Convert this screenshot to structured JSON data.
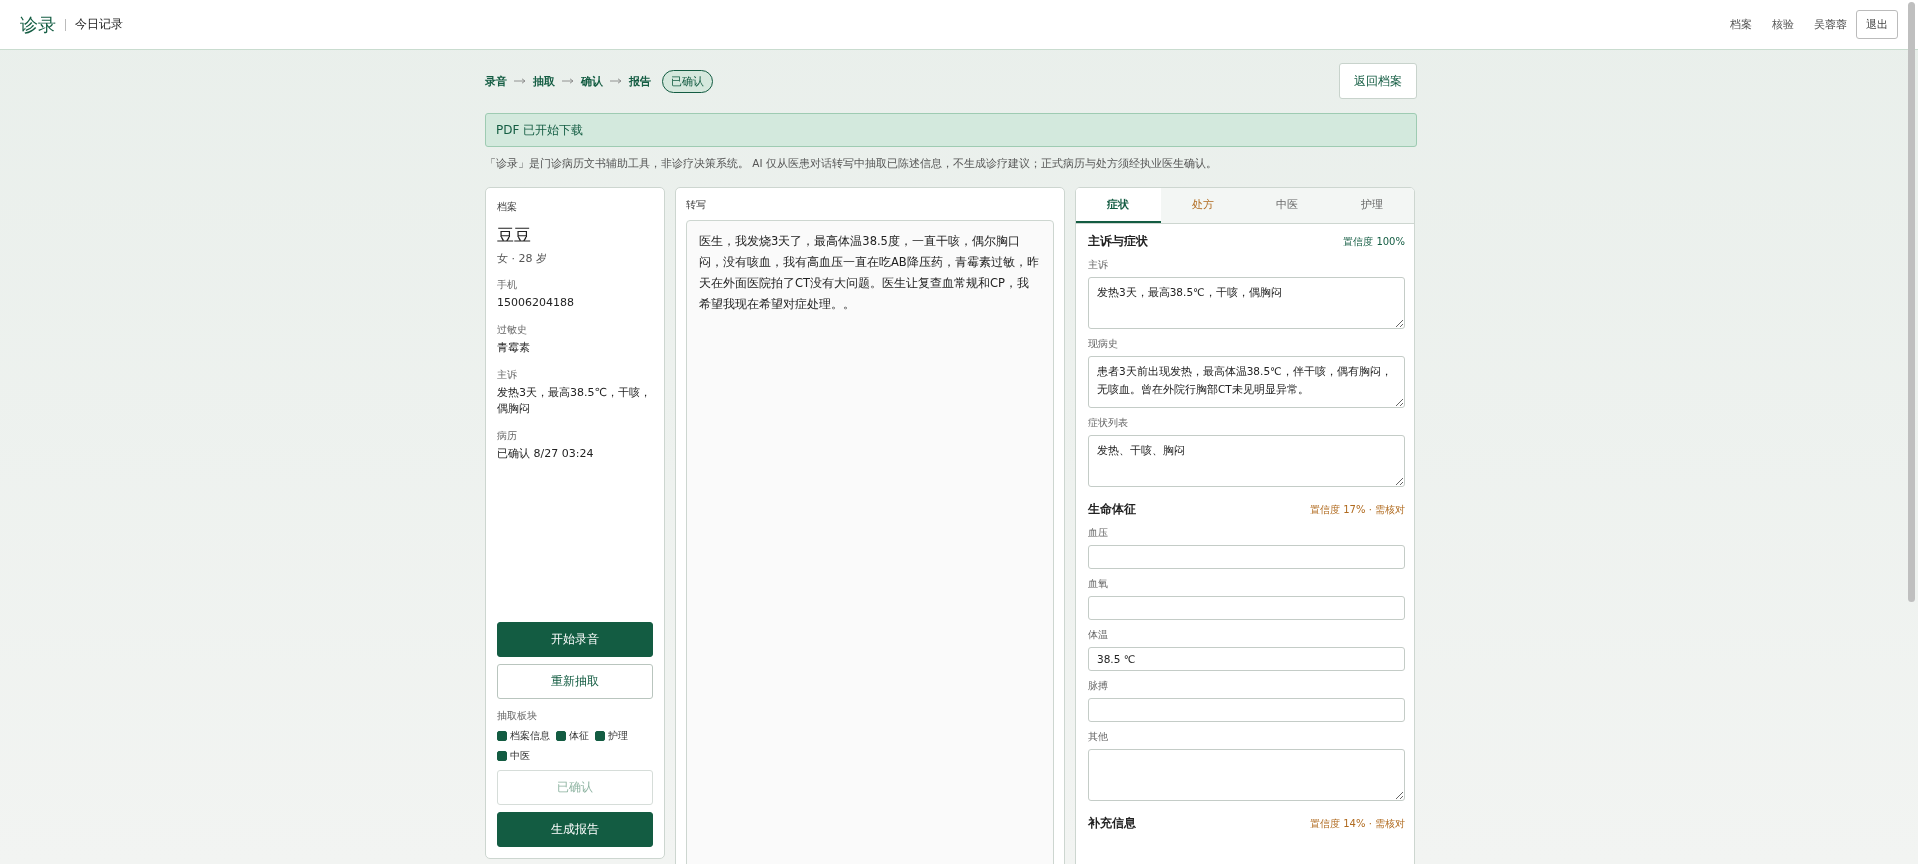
{
  "header": {
    "logo": "诊录",
    "subtitle": "今日记录",
    "nav": [
      "档案",
      "核验"
    ],
    "user": "吴蓉蓉",
    "logout": "退出"
  },
  "steps": [
    "录音",
    "抽取",
    "确认",
    "报告"
  ],
  "status_badge": "已确认",
  "back_button": "返回档案",
  "alert": "PDF 已开始下载",
  "disclaimer": "「诊录」是门诊病历文书辅助工具，非诊疗决策系统。 AI 仅从医患对话转写中抽取已陈述信息，不生成诊疗建议；正式病历与处方须经执业医生确认。",
  "profile": {
    "title": "档案",
    "name": "豆豆",
    "meta": "女 · 28 岁",
    "fields": [
      {
        "label": "手机",
        "value": "15006204188"
      },
      {
        "label": "过敏史",
        "value": "青霉素"
      },
      {
        "label": "主诉",
        "value": "发热3天，最高38.5℃，干咳，偶胸闷"
      },
      {
        "label": "病历",
        "value": "已确认 8/27 03:24"
      }
    ],
    "buttons_top": [
      {
        "label": "开始录音",
        "kind": "primary",
        "disabled": false
      },
      {
        "label": "重新抽取",
        "kind": "outline",
        "disabled": false
      }
    ],
    "modules_label": "抽取板块",
    "modules": [
      {
        "label": "档案信息",
        "checked": true
      },
      {
        "label": "体征",
        "checked": true
      },
      {
        "label": "护理",
        "checked": true
      },
      {
        "label": "中医",
        "checked": true
      }
    ],
    "buttons_bottom": [
      {
        "label": "已确认",
        "kind": "outline",
        "disabled": true
      },
      {
        "label": "生成报告",
        "kind": "primary",
        "disabled": false
      }
    ]
  },
  "transcript": {
    "title": "转写",
    "text": "医生，我发烧3天了，最高体温38.5度，一直干咳，偶尔胸口闷，没有咳血，我有高血压一直在吃AB降压药，青霉素过敏，昨天在外面医院拍了CT没有大问题。医生让复查血常规和CP，我希望我现在希望对症处理。。"
  },
  "tabs": [
    {
      "label": "症状",
      "selected": true,
      "warning": false
    },
    {
      "label": "处方",
      "selected": false,
      "warning": true
    },
    {
      "label": "中医",
      "selected": false,
      "warning": false
    },
    {
      "label": "护理",
      "selected": false,
      "warning": false
    }
  ],
  "sections": [
    {
      "title": "主诉与症状",
      "confidence": "置信度 100%",
      "warning": false,
      "fields": [
        {
          "label": "主诉",
          "kind": "textarea",
          "value": "发热3天，最高38.5℃，干咳，偶胸闷"
        },
        {
          "label": "现病史",
          "kind": "textarea",
          "value": "患者3天前出现发热，最高体温38.5℃，伴干咳，偶有胸闷，无咳血。曾在外院行胸部CT未见明显异常。"
        },
        {
          "label": "症状列表",
          "kind": "textarea",
          "value": "发热、干咳、胸闷"
        }
      ]
    },
    {
      "title": "生命体征",
      "confidence": "置信度 17% · 需核对",
      "warning": true,
      "fields": [
        {
          "label": "血压",
          "kind": "input"
        },
        {
          "label": "血氧",
          "kind": "input"
        },
        {
          "label": "体温",
          "kind": "input",
          "value": "38.5 ℃"
        },
        {
          "label": "脉搏",
          "kind": "input"
        },
        {
          "label": "其他",
          "kind": "textarea"
        }
      ]
    },
    {
      "title": "补充信息",
      "confidence": "置信度 14% · 需核对",
      "warning": true
    }
  ]
}
